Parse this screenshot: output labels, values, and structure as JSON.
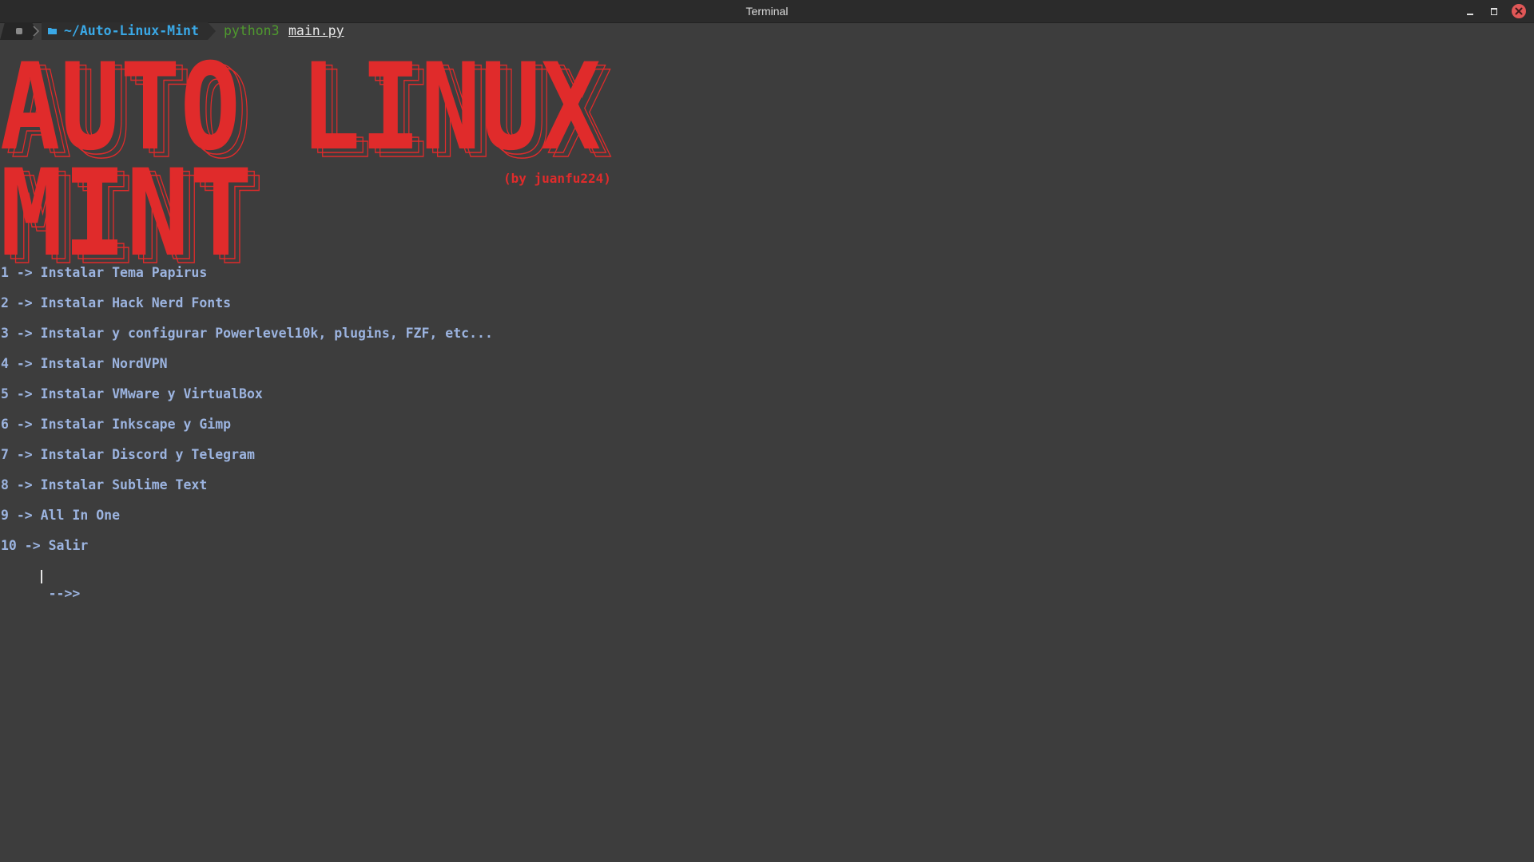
{
  "window": {
    "title": "Terminal"
  },
  "prompt": {
    "os_icon": "linux-icon",
    "folder_icon": "folder-icon",
    "directory": "~/Auto-Linux-Mint",
    "command": "python3",
    "argument": "main.py"
  },
  "banner": {
    "title_line_1": "AUTO LINUX",
    "title_line_2": "MINT",
    "byline": "(by juanfu224)",
    "color": "#e02b2b"
  },
  "menu": {
    "items": [
      "1 -> Instalar Tema Papirus",
      "2 -> Instalar Hack Nerd Fonts",
      "3 -> Instalar y configurar Powerlevel10k, plugins, FZF, etc...",
      "4 -> Instalar NordVPN",
      "5 -> Instalar VMware y VirtualBox",
      "6 -> Instalar Inkscape y Gimp",
      "7 -> Instalar Discord y Telegram",
      "8 -> Instalar Sublime Text",
      "9 -> All In One",
      "10 -> Salir"
    ],
    "color": "#9cb4e0"
  },
  "input": {
    "prompt": "-->>",
    "value": ""
  }
}
